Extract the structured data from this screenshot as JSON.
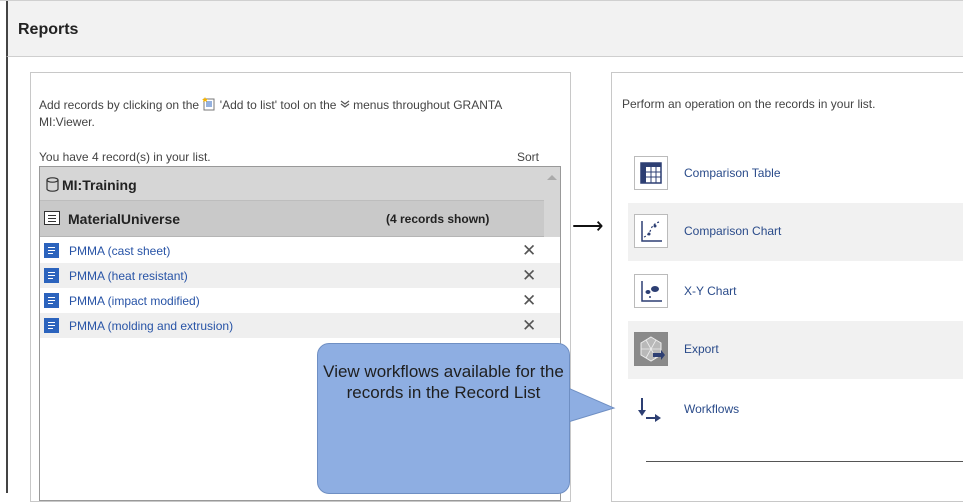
{
  "header": {
    "title": "Reports"
  },
  "left_panel": {
    "intro_part1": "Add records by clicking on the",
    "intro_part2": "'Add to list' tool on the",
    "intro_part3": "menus throughout GRANTA MI:Viewer.",
    "count_text": "You have 4 record(s) in your list.",
    "sort_label": "Sort",
    "database": {
      "name": "MI:Training"
    },
    "table": {
      "name": "MaterialUniverse",
      "shown": "(4 records shown)"
    },
    "records": [
      {
        "label": "PMMA (cast sheet)",
        "remove": "✕"
      },
      {
        "label": "PMMA (heat resistant)",
        "remove": "✕"
      },
      {
        "label": "PMMA (impact modified)",
        "remove": "✕"
      },
      {
        "label": "PMMA (molding and extrusion)",
        "remove": "✕"
      }
    ]
  },
  "arrow": "⟶",
  "right_panel": {
    "intro": "Perform an operation on the records in your list.",
    "operations": [
      {
        "label": "Comparison Table",
        "icon": "comparison-table-icon"
      },
      {
        "label": "Comparison Chart",
        "icon": "comparison-chart-icon"
      },
      {
        "label": "X-Y Chart",
        "icon": "xy-chart-icon"
      },
      {
        "label": "Export",
        "icon": "export-icon"
      },
      {
        "label": "Workflows",
        "icon": "workflows-icon"
      }
    ]
  },
  "callout": {
    "text": "View workflows available for the records in the Record List"
  },
  "colors": {
    "link": "#2753a6",
    "record_icon": "#2b63bd",
    "callout": "#8eaee2"
  }
}
